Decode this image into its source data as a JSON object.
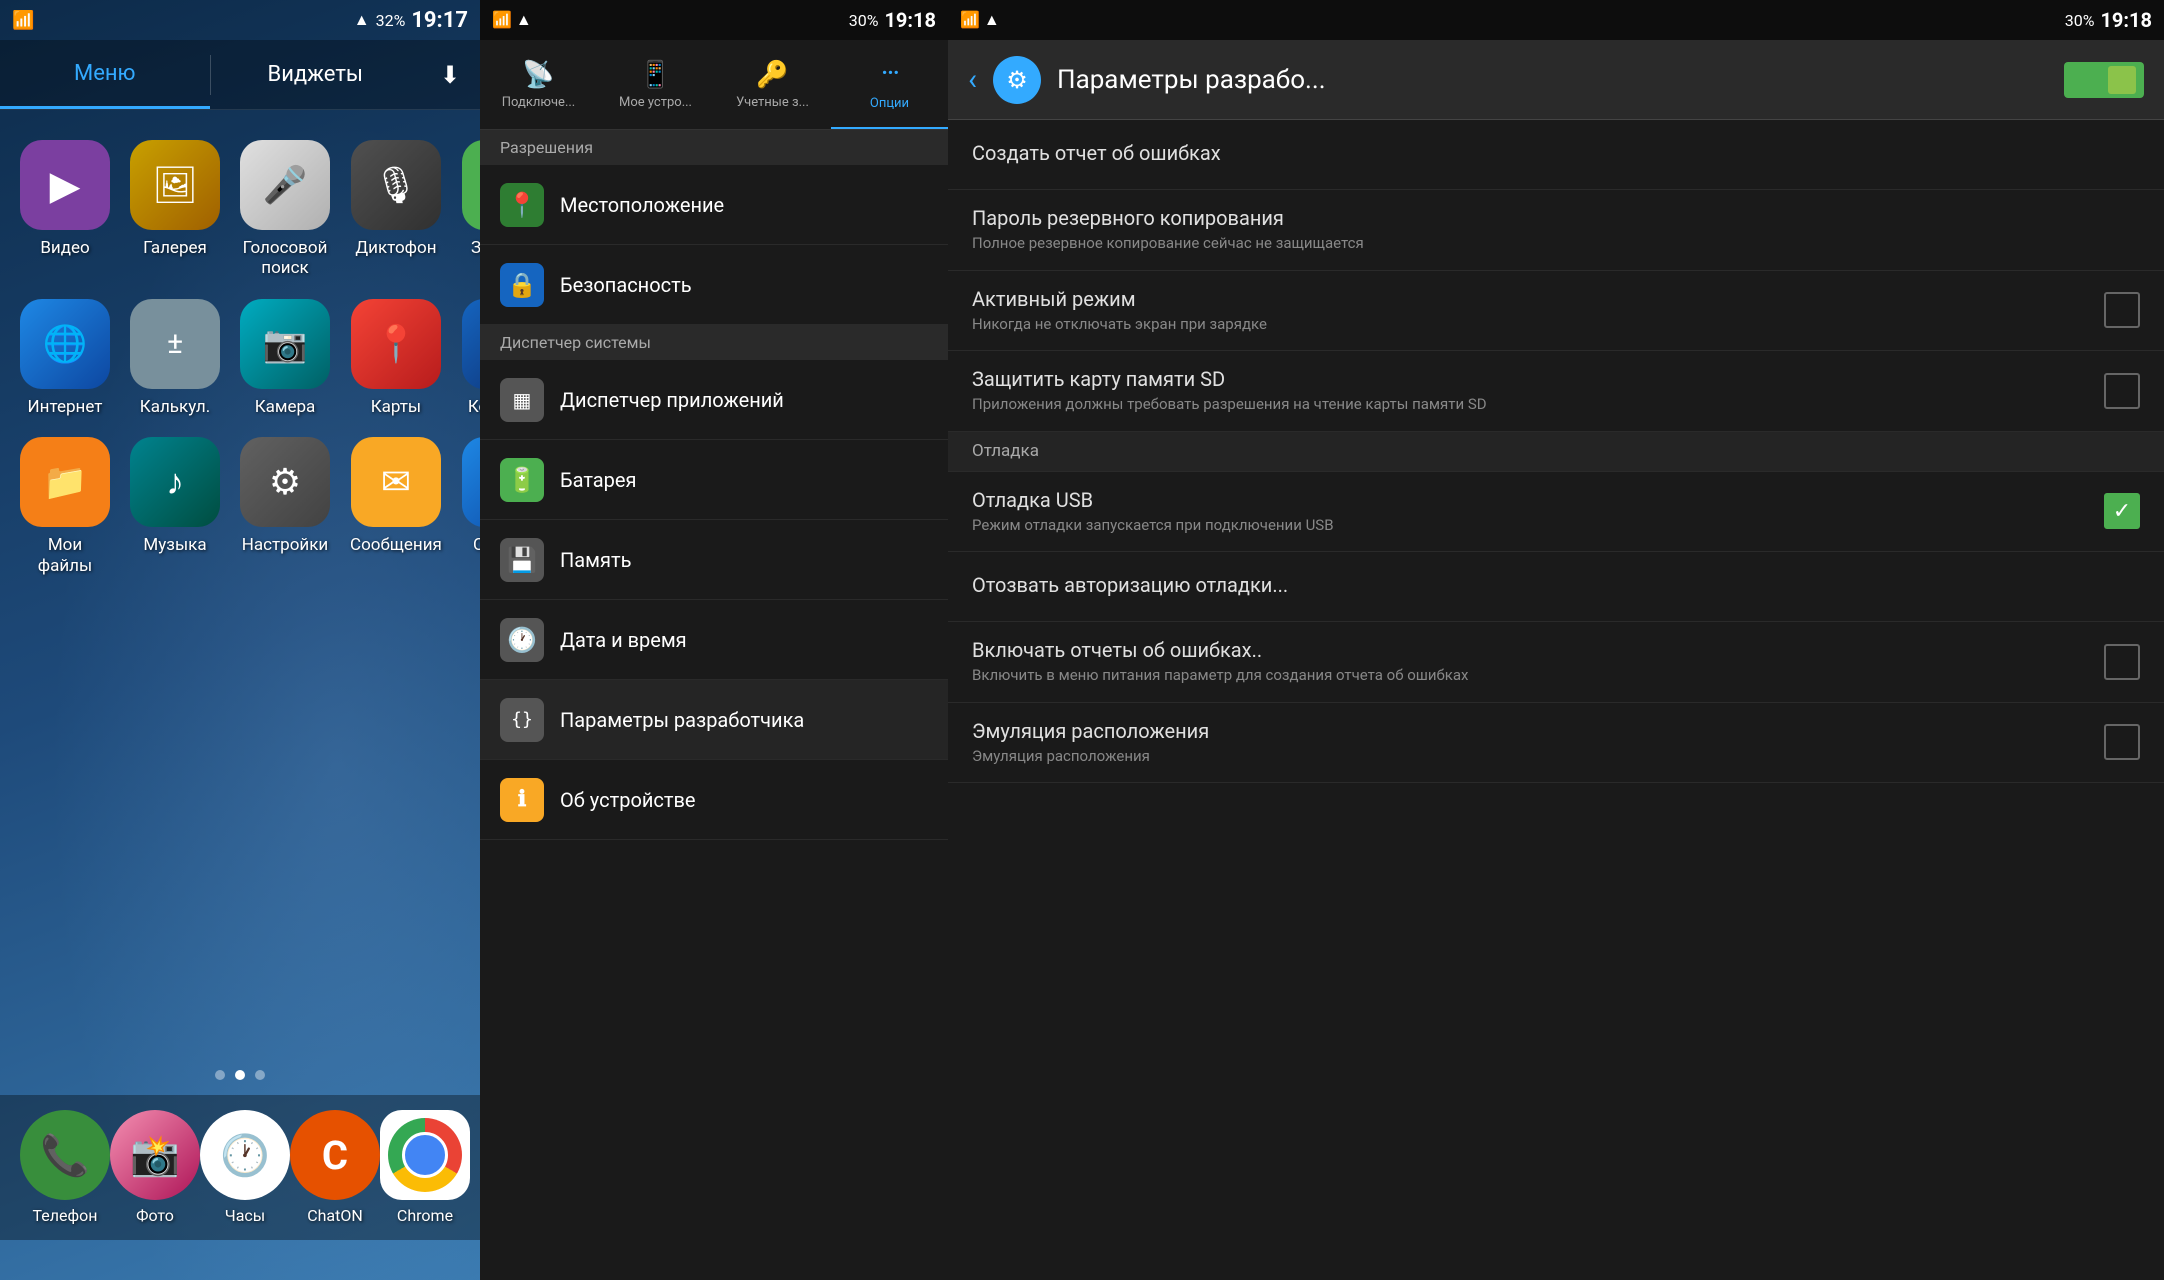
{
  "home": {
    "status": {
      "time": "19:17",
      "battery": "32%",
      "signal": "●●●"
    },
    "tabs": [
      {
        "label": "Меню",
        "active": true
      },
      {
        "label": "Виджеты",
        "active": false
      }
    ],
    "apps": [
      {
        "name": "Видео",
        "icon": "▶",
        "color": "icon-purple"
      },
      {
        "name": "Галерея",
        "icon": "🖼",
        "color": "icon-yellow-brown"
      },
      {
        "name": "Голосовой поиск",
        "icon": "🎤",
        "color": "icon-gray-mic"
      },
      {
        "name": "Диктофон",
        "icon": "🎙",
        "color": "icon-dark-mic"
      },
      {
        "name": "Загрузки",
        "icon": "⬇",
        "color": "icon-green-download"
      },
      {
        "name": "Интернет",
        "icon": "🌐",
        "color": "icon-blue-globe"
      },
      {
        "name": "Калькул.",
        "icon": "±",
        "color": "icon-gray-calc"
      },
      {
        "name": "Камера",
        "icon": "📷",
        "color": "icon-teal-cam"
      },
      {
        "name": "Карты",
        "icon": "📍",
        "color": "icon-red-maps"
      },
      {
        "name": "Контакты",
        "icon": "👤",
        "color": "icon-blue-contact"
      },
      {
        "name": "Мои файлы",
        "icon": "📁",
        "color": "icon-yellow-files"
      },
      {
        "name": "Музыка",
        "icon": "♪",
        "color": "icon-teal-music"
      },
      {
        "name": "Настройки",
        "icon": "⚙",
        "color": "icon-gray-settings"
      },
      {
        "name": "Сообщения",
        "icon": "✉",
        "color": "icon-yellow-msg"
      },
      {
        "name": "Справка",
        "icon": "?",
        "color": "icon-blue-help"
      }
    ],
    "dock": [
      {
        "name": "Телефон",
        "icon": "📞",
        "color": "#388e3c"
      },
      {
        "name": "Фото",
        "icon": "📸",
        "color": "#ad1457"
      },
      {
        "name": "Часы",
        "icon": "🕐",
        "color": "white"
      },
      {
        "name": "ChatON",
        "icon": "C",
        "color": "#e65100"
      },
      {
        "name": "Chrome",
        "icon": "chrome",
        "color": "white"
      }
    ]
  },
  "settings": {
    "status": {
      "time": "19:18",
      "battery": "30%"
    },
    "tabs": [
      {
        "id": "podklyuchenie",
        "label": "Подключе...",
        "icon": "📡",
        "active": false
      },
      {
        "id": "moyo-ustro",
        "label": "Мое устро...",
        "icon": "📱",
        "active": false
      },
      {
        "id": "uchetnye-zapisi",
        "label": "Учетные з...",
        "icon": "🔑",
        "active": false
      },
      {
        "id": "optsii",
        "label": "Опции",
        "icon": "⋯",
        "active": true
      }
    ],
    "section_header": "Разрешения",
    "items": [
      {
        "id": "mestopolozhenie",
        "label": "Местоположение",
        "icon": "📍",
        "iconBg": "#4caf50",
        "section": false
      },
      {
        "id": "bezopasnost",
        "label": "Безопасность",
        "icon": "🔒",
        "iconBg": "#2196f3",
        "section": false
      },
      {
        "id": "dispetcher-sistemy",
        "label": "Диспетчер системы",
        "icon": "",
        "iconBg": "",
        "section": true
      },
      {
        "id": "dispetcher-prilozheny",
        "label": "Диспетчер приложений",
        "icon": "▦",
        "iconBg": "#555",
        "section": false
      },
      {
        "id": "batareja",
        "label": "Батарея",
        "icon": "🔋",
        "iconBg": "#4caf50",
        "section": false
      },
      {
        "id": "pamyat",
        "label": "Память",
        "icon": "💾",
        "iconBg": "#555",
        "section": false
      },
      {
        "id": "data-i-vremya",
        "label": "Дата и время",
        "icon": "🕐",
        "iconBg": "#555",
        "section": false
      },
      {
        "id": "parametry-razrabotchika",
        "label": "Параметры разработчика",
        "icon": "{}",
        "iconBg": "#555",
        "section": false
      },
      {
        "id": "ob-ustroystve",
        "label": "Об устройстве",
        "icon": "ℹ",
        "iconBg": "#f9a825",
        "section": false
      }
    ]
  },
  "devOptions": {
    "status": {
      "time": "19:18",
      "battery": "30%"
    },
    "header": {
      "title": "Параметры разрабо...",
      "back_label": "‹",
      "toggle_enabled": true
    },
    "items": [
      {
        "id": "create-report",
        "title": "Создать отчет об ошибках",
        "subtitle": "",
        "type": "item",
        "checked": null
      },
      {
        "id": "backup-password",
        "title": "Пароль резервного копирования",
        "subtitle": "Полное резервное копирование сейчас не защищается",
        "type": "item",
        "checked": null
      },
      {
        "id": "active-mode",
        "title": "Активный режим",
        "subtitle": "Никогда не отключать экран при зарядке",
        "type": "checkbox",
        "checked": false
      },
      {
        "id": "protect-sd",
        "title": "Защитить карту памяти SD",
        "subtitle": "Приложения должны требовать разрешения на чтение карты памяти SD",
        "type": "checkbox",
        "checked": false
      },
      {
        "id": "otladka-section",
        "title": "Отладка",
        "subtitle": "",
        "type": "section",
        "checked": null
      },
      {
        "id": "usb-debug",
        "title": "Отладка USB",
        "subtitle": "Режим отладки запускается при подключении USB",
        "type": "checkbox",
        "checked": true
      },
      {
        "id": "revoke-debug-auth",
        "title": "Отозвать авторизацию отладки...",
        "subtitle": "",
        "type": "item",
        "checked": null
      },
      {
        "id": "enable-error-reports",
        "title": "Включать отчеты об ошибках..",
        "subtitle": "Включить в меню питания параметр для создания отчета об ошибках",
        "type": "checkbox",
        "checked": false
      },
      {
        "id": "emulation-location",
        "title": "Эмуляция расположения",
        "subtitle": "Эмуляция расположения",
        "type": "checkbox",
        "checked": false
      }
    ]
  }
}
